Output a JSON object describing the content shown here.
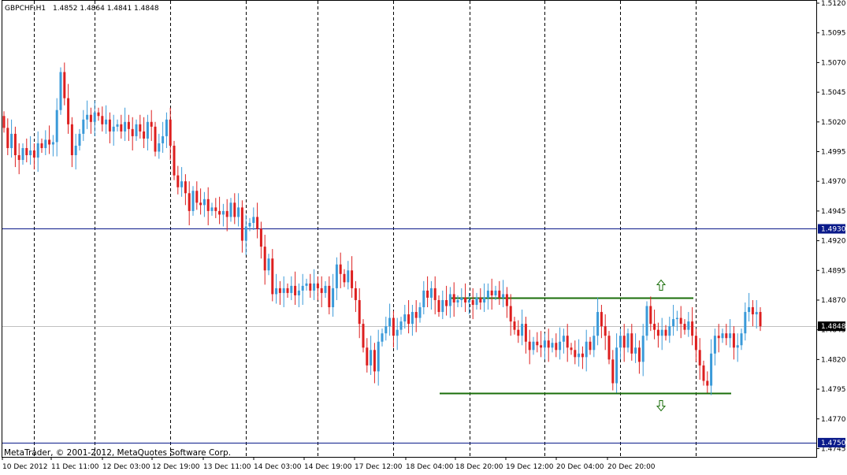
{
  "header": {
    "symbol": "GBPCHF,H1",
    "ohlc": "1.4852 1.4864 1.4841 1.4848"
  },
  "footer": {
    "copyright": "MetaTrader, © 2001-2012, MetaQuotes Software Corp."
  },
  "colors": {
    "background": "#ffffff",
    "frame": "#000000",
    "grid": "#000000",
    "bull": "#3a9ad9",
    "bear": "#dd1f1f",
    "hline": "#0a1a8a",
    "price_line": "#c0c0c0",
    "channel": "#1a6e0a",
    "label_bg": "#0a1a8a",
    "label_text": "#ffffff",
    "current_bg": "#000000"
  },
  "chart_data": {
    "type": "candlestick",
    "y_ticks": [
      "1.5120",
      "1.5095",
      "1.5070",
      "1.5045",
      "1.5020",
      "1.4995",
      "1.4970",
      "1.4945",
      "1.4920",
      "1.4895",
      "1.4870",
      "1.4845",
      "1.4820",
      "1.4795",
      "1.4770",
      "1.4745"
    ],
    "y_range": [
      1.4738,
      1.5122
    ],
    "x_labels": [
      "10 Dec 2012",
      "11 Dec 11:00",
      "12 Dec 03:00",
      "12 Dec 19:00",
      "13 Dec 11:00",
      "14 Dec 03:00",
      "14 Dec 19:00",
      "17 Dec 12:00",
      "18 Dec 04:00",
      "18 Dec 20:00",
      "19 Dec 12:00",
      "20 Dec 04:00",
      "20 Dec 20:00"
    ],
    "horizontal_lines": [
      {
        "price": 1.493,
        "label": "1.4930"
      },
      {
        "price": 1.475,
        "label": "1.4750"
      }
    ],
    "current_price": {
      "price": 1.4848,
      "label": "1.4848"
    },
    "channel": [
      {
        "price": 1.4872,
        "arrow": "up"
      },
      {
        "price": 1.4792,
        "arrow": "down"
      }
    ],
    "closes": [
      1.5015,
      1.4998,
      1.501,
      1.4992,
      1.4988,
      1.4998,
      1.4992,
      1.4996,
      1.499,
      1.5002,
      1.4998,
      1.5005,
      1.5001,
      1.5003,
      1.503,
      1.5062,
      1.504,
      1.5018,
      1.4992,
      1.5,
      1.501,
      1.5022,
      1.5026,
      1.502,
      1.5028,
      1.5025,
      1.5018,
      1.5022,
      1.5012,
      1.5016,
      1.5018,
      1.5012,
      1.502,
      1.5014,
      1.5008,
      1.5018,
      1.5012,
      1.5006,
      1.502,
      1.5016,
      1.4995,
      1.5002,
      1.5008,
      1.5022,
      1.5,
      1.4975,
      1.4965,
      1.497,
      1.496,
      1.4945,
      1.4962,
      1.4952,
      1.495,
      1.4955,
      1.4945,
      1.4948,
      1.4945,
      1.4942,
      1.4945,
      1.494,
      1.4952,
      1.494,
      1.4948,
      1.492,
      1.4932,
      1.4935,
      1.494,
      1.493,
      1.4915,
      1.4895,
      1.4905,
      1.4875,
      1.488,
      1.4876,
      1.488,
      1.4876,
      1.4882,
      1.4874,
      1.4878,
      1.4882,
      1.4884,
      1.4878,
      1.4884,
      1.488,
      1.4876,
      1.4882,
      1.4864,
      1.488,
      1.49,
      1.4892,
      1.4885,
      1.4895,
      1.488,
      1.487,
      1.485,
      1.483,
      1.4815,
      1.4828,
      1.481,
      1.4835,
      1.4842,
      1.4848,
      1.4855,
      1.484,
      1.4845,
      1.4852,
      1.4858,
      1.485,
      1.486,
      1.4855,
      1.4864,
      1.4878,
      1.4872,
      1.488,
      1.487,
      1.486,
      1.487,
      1.4865,
      1.4875,
      1.4868,
      1.487,
      1.4872,
      1.4868,
      1.487,
      1.4866,
      1.4872,
      1.4868,
      1.4872,
      1.4878,
      1.4874,
      1.4878,
      1.4872,
      1.4875,
      1.4865,
      1.4852,
      1.4845,
      1.484,
      1.485,
      1.4835,
      1.4828,
      1.4835,
      1.4832,
      1.483,
      1.4836,
      1.483,
      1.4834,
      1.4828,
      1.4835,
      1.484,
      1.483,
      1.4828,
      1.4822,
      1.4825,
      1.4822,
      1.4835,
      1.4828,
      1.484,
      1.486,
      1.4848,
      1.484,
      1.482,
      1.48,
      1.483,
      1.484,
      1.483,
      1.4842,
      1.4825,
      1.483,
      1.4818,
      1.484,
      1.4865,
      1.485,
      1.4845,
      1.484,
      1.4845,
      1.484,
      1.4848,
      1.4854,
      1.4855,
      1.485,
      1.4845,
      1.4852,
      1.484,
      1.4828,
      1.4815,
      1.4802,
      1.4798,
      1.4825,
      1.484,
      1.4838,
      1.4842,
      1.4838,
      1.4842,
      1.483,
      1.4832,
      1.4842,
      1.486,
      1.4864,
      1.4858,
      1.486,
      1.4848
    ]
  }
}
